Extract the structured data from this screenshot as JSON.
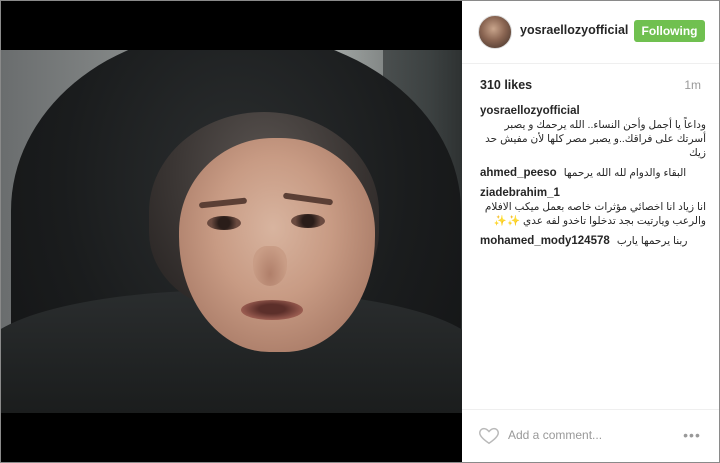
{
  "post": {
    "username": "yosraellozyofficial",
    "follow_label": "Following",
    "likes": "310 likes",
    "time": "1m"
  },
  "comments": [
    {
      "user": "yosraellozyofficial",
      "text": "وداعاً يا أجمل وأحن النساء.. الله يرحمك و يصبر أسرتك على فراقك..و يصبر مصر كلها لأن مفيش حد زيك"
    },
    {
      "user": "ahmed_peeso",
      "text": "البقاء والدوام لله الله يرحمها"
    },
    {
      "user": "ziadebrahim_1",
      "text": "انا زياد انا اخصائي مؤثرات خاصه بعمل ميكب الافلام والرعب ويارتيت بجد تدخلوا تاخدو لفه عدي ✨✨"
    },
    {
      "user": "mohamed_mody124578",
      "text": "ربنا يرحمها يارب"
    }
  ],
  "footer": {
    "comment_placeholder": "Add a comment...",
    "more_label": "•••"
  },
  "colors": {
    "follow_button": "#70c050",
    "muted_text": "#999999",
    "primary_text": "#262626"
  },
  "icons": {
    "like": "heart-outline-icon",
    "more": "ellipsis-icon"
  }
}
